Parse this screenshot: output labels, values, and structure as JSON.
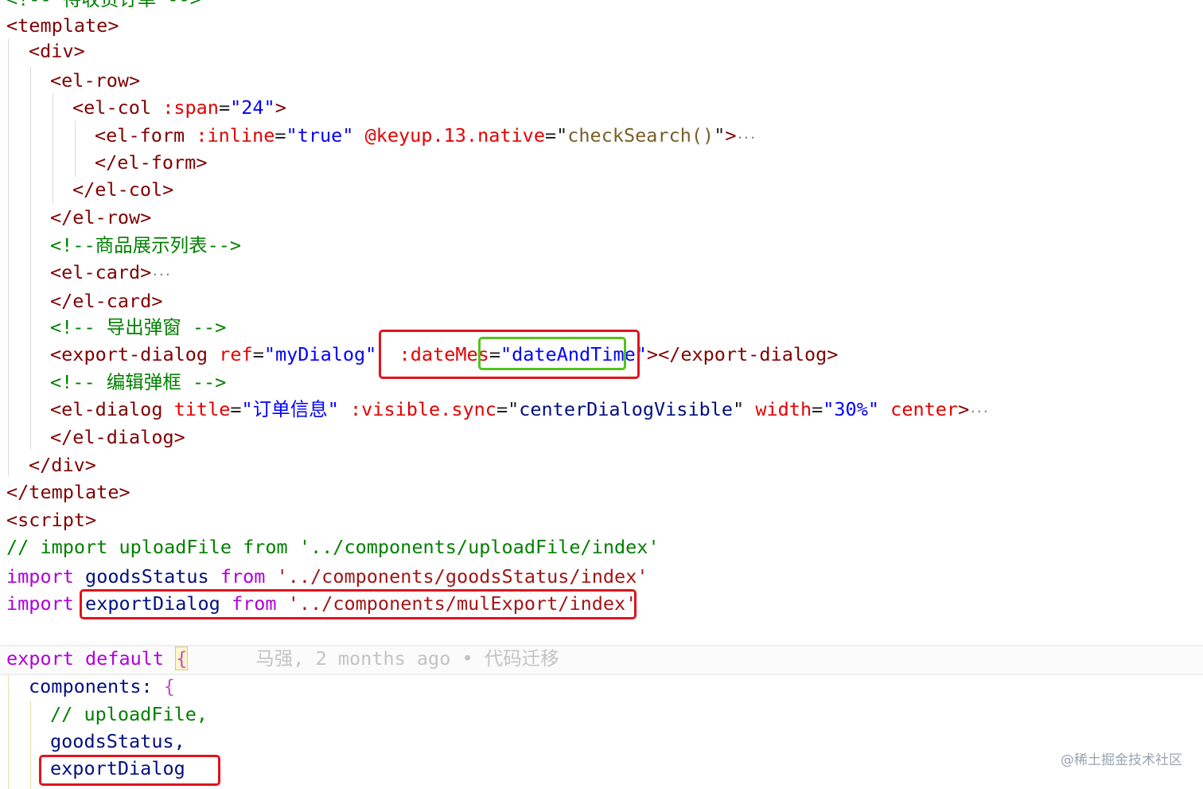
{
  "code": {
    "l0_top": "<!-- 待收货订单 -->",
    "l1": "<template>",
    "l2": "<div>",
    "l3": "<el-row>",
    "l4_tag": "<el-col",
    "l4_attr": ":span",
    "l4_val": "\"24\"",
    "l5_tag": "<el-form",
    "l5_attr1": ":inline",
    "l5_val1": "\"true\"",
    "l5_attr2": "@keyup.13.native",
    "l5_val2": "checkSearch()",
    "l6": "</el-form>",
    "l7": "</el-col>",
    "l8": "</el-row>",
    "l9": "<!--商品展示列表-->",
    "l10": "<el-card>",
    "l11": "</el-card>",
    "l12": "<!-- 导出弹窗 -->",
    "l13_tag": "<export-dialog",
    "l13_attr1": "ref",
    "l13_val1": "\"myDialog\"",
    "l13_attr2": ":dateMes",
    "l13_val2": "\"dateAndTime\"",
    "l13_close": "</export-dialog>",
    "l14": "<!-- 编辑弹框 -->",
    "l15_tag": "<el-dialog",
    "l15_attr1": "title",
    "l15_val1": "\"订单信息\"",
    "l15_attr2": ":visible.sync",
    "l15_val2": "\"centerDialogVisible\"",
    "l15_attr3": "width",
    "l15_val3": "\"30%\"",
    "l15_attr4": "center",
    "l16": "</el-dialog>",
    "l17": "</div>",
    "l18": "</template>",
    "l19": "<script>",
    "l20": "// import uploadFile from '../components/uploadFile/index'",
    "l21_kw": "import",
    "l21_id": "goodsStatus",
    "l21_from": "from",
    "l21_str": "'../components/goodsStatus/index'",
    "l22_kw": "import",
    "l22_id": "exportDialog",
    "l22_from": "from",
    "l22_str": "'../components/mulExport/index'",
    "l23_kw": "export default",
    "l23_brace": "{",
    "blame": "马强, 2 months ago • 代码迁移",
    "l24": "components:",
    "l24_brace": "{",
    "l25": "// uploadFile,",
    "l26": "goodsStatus,",
    "l27": "exportDialog"
  },
  "watermark": "@稀土掘金技术社区"
}
